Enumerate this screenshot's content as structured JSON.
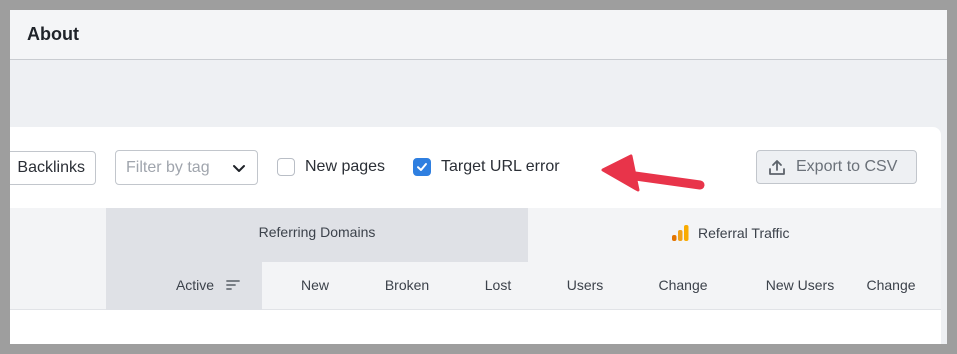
{
  "header": {
    "title": "About"
  },
  "toolbar": {
    "backlinks_label": "Backlinks",
    "filter_placeholder": "Filter by tag",
    "new_pages_label": "New pages",
    "new_pages_checked": false,
    "target_url_error_label": "Target URL error",
    "target_url_error_checked": true,
    "export_label": "Export to CSV"
  },
  "table": {
    "group_headers": {
      "referring_domains": "Referring Domains",
      "referral_traffic": "Referral Traffic"
    },
    "columns": [
      "Active",
      "New",
      "Broken",
      "Lost",
      "Users",
      "Change",
      "New Users",
      "Change"
    ]
  },
  "colors": {
    "accent": "#2f7fe0",
    "annotation_arrow": "#e8344a",
    "analytics_icon": "#f0a21a"
  },
  "icons": [
    "chevron-down-icon",
    "checkmark-icon",
    "upload-icon",
    "analytics-icon",
    "sort-icon",
    "arrow-annotation-icon"
  ]
}
